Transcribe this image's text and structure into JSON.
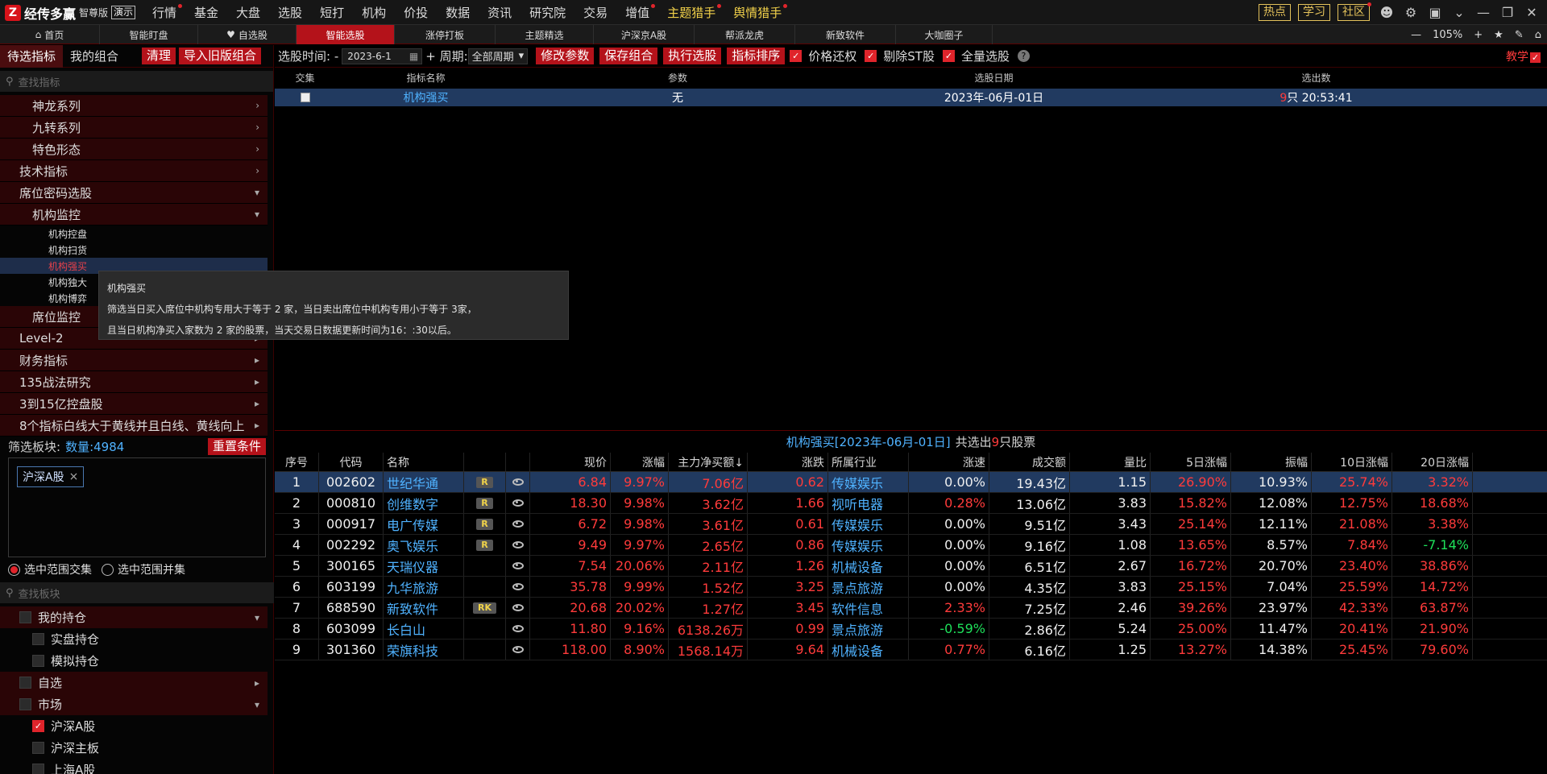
{
  "app": {
    "name": "经传多赢",
    "edition": "智尊版",
    "demo": "演示"
  },
  "top_menu": [
    {
      "label": "行情",
      "dot": true,
      "gold": false
    },
    {
      "label": "基金",
      "dot": false,
      "gold": false
    },
    {
      "label": "大盘",
      "dot": false,
      "gold": false
    },
    {
      "label": "选股",
      "dot": false,
      "gold": false
    },
    {
      "label": "短打",
      "dot": false,
      "gold": false
    },
    {
      "label": "机构",
      "dot": false,
      "gold": false
    },
    {
      "label": "价投",
      "dot": false,
      "gold": false
    },
    {
      "label": "数据",
      "dot": false,
      "gold": false
    },
    {
      "label": "资讯",
      "dot": false,
      "gold": false
    },
    {
      "label": "研究院",
      "dot": false,
      "gold": false
    },
    {
      "label": "交易",
      "dot": false,
      "gold": false
    },
    {
      "label": "增值",
      "dot": true,
      "gold": false
    },
    {
      "label": "主题猎手",
      "dot": true,
      "gold": true
    },
    {
      "label": "舆情猎手",
      "dot": true,
      "gold": true
    }
  ],
  "top_right": {
    "hot": "热点",
    "learn": "学习",
    "community": "社区"
  },
  "tabs": [
    {
      "label": "首页",
      "icon": "home-icon"
    },
    {
      "label": "智能盯盘",
      "icon": ""
    },
    {
      "label": "自选股",
      "icon": "heart-icon"
    },
    {
      "label": "智能选股",
      "icon": "",
      "active": true
    },
    {
      "label": "涨停打板",
      "icon": ""
    },
    {
      "label": "主题精选",
      "icon": ""
    },
    {
      "label": "沪深京A股",
      "icon": ""
    },
    {
      "label": "帮派龙虎",
      "icon": ""
    },
    {
      "label": "新致软件",
      "icon": ""
    },
    {
      "label": "大咖圈子",
      "icon": ""
    }
  ],
  "zoom": "105%",
  "left": {
    "tab_pending": "待选指标",
    "tab_combo": "我的组合",
    "clear": "清理",
    "import_old": "导入旧版组合",
    "search_placeholder": "查找指标",
    "tree_top": [
      {
        "label": "神龙系列",
        "indent": 40
      },
      {
        "label": "九转系列",
        "indent": 40
      },
      {
        "label": "特色形态",
        "indent": 40
      },
      {
        "label": "技术指标",
        "indent": 24
      },
      {
        "label": "席位密码选股",
        "indent": 24,
        "open": true
      },
      {
        "label": "机构监控",
        "indent": 40,
        "open": true
      }
    ],
    "leaves": [
      "机构控盘",
      "机构扫货",
      "机构强买",
      "机构独大",
      "机构博弈"
    ],
    "selected_leaf": "机构强买",
    "tree_bottom": [
      {
        "label": "席位监控",
        "indent": 40
      },
      {
        "label": "Level-2",
        "indent": 24
      },
      {
        "label": "财务指标",
        "indent": 24
      },
      {
        "label": "135战法研究",
        "indent": 24
      },
      {
        "label": "3到15亿控盘股",
        "indent": 24
      },
      {
        "label": "8个指标白线大于黄线并且白线、黄线向上",
        "indent": 24
      }
    ],
    "filter_label": "筛选板块:",
    "filter_count": "数量:4984",
    "reset": "重置条件",
    "chip": "沪深A股",
    "radio_intersect": "选中范围交集",
    "radio_union": "选中范围并集",
    "board_search_placeholder": "查找板块",
    "board_tree": [
      {
        "label": "我的持仓",
        "indent": 24,
        "dark": true,
        "arrow": "▾",
        "check": false
      },
      {
        "label": "实盘持仓",
        "indent": 40,
        "dark": false,
        "arrow": "",
        "check": false
      },
      {
        "label": "模拟持仓",
        "indent": 40,
        "dark": false,
        "arrow": "",
        "check": false
      },
      {
        "label": "自选",
        "indent": 24,
        "dark": true,
        "arrow": "▸",
        "check": false
      },
      {
        "label": "市场",
        "indent": 24,
        "dark": true,
        "arrow": "▾",
        "check": false
      },
      {
        "label": "沪深A股",
        "indent": 40,
        "dark": false,
        "arrow": "",
        "check": true
      },
      {
        "label": "沪深主板",
        "indent": 40,
        "dark": false,
        "arrow": "",
        "check": false
      },
      {
        "label": "上海A股",
        "indent": 40,
        "dark": false,
        "arrow": "",
        "check": false
      }
    ]
  },
  "tooltip": {
    "title": "机构强买",
    "line1": "筛选当日买入席位中机构专用大于等于 2 家，当日卖出席位中机构专用小于等于 3家，",
    "line2": "且当日机构净买入家数为 2 家的股票，当天交易日数据更新时间为16：:30以后。"
  },
  "toolbar": {
    "select_time": "选股时间: -",
    "date": "2023-6-1",
    "period_label": "+ 周期:",
    "period_value": "全部周期",
    "modify": "修改参数",
    "save": "保存组合",
    "run": "执行选股",
    "sort": "指标排序",
    "price_adjust": "价格还权",
    "exclude_st": "剔除ST股",
    "full": "全量选股",
    "help": "?",
    "teach": "教学"
  },
  "strategy": {
    "headers": [
      "交集",
      "指标名称",
      "参数",
      "选股日期",
      "选出数"
    ],
    "row": {
      "name": "机构强买",
      "params": "无",
      "date": "2023年-06月-01日",
      "count": "9",
      "count_suffix": "只 20:53:41"
    }
  },
  "results": {
    "title": "机构强买[2023年-06月-01日]",
    "summary_pre": "共选出",
    "count": "9",
    "summary_post": "只股票"
  },
  "stock_table": {
    "headers": [
      "序号",
      "代码",
      "名称",
      "",
      "",
      "现价",
      "涨幅",
      "主力净买额↓",
      "涨跌",
      "所属行业",
      "涨速",
      "成交额",
      "量比",
      "5日涨幅",
      "振幅",
      "10日涨幅",
      "20日涨幅"
    ],
    "rows": [
      {
        "no": "1",
        "code": "002602",
        "name": "世纪华通",
        "badge": "R",
        "price": "6.84",
        "chg": "9.97%",
        "net": "7.06亿",
        "change": "0.62",
        "industry": "传媒娱乐",
        "speed": "0.00%",
        "amount": "19.43亿",
        "ratio": "1.15",
        "d5": "26.90%",
        "amp": "10.93%",
        "d10": "25.74%",
        "d20": "3.32%",
        "speed_cls": "white",
        "d20_cls": "red",
        "sel": true
      },
      {
        "no": "2",
        "code": "000810",
        "name": "创维数字",
        "badge": "R",
        "price": "18.30",
        "chg": "9.98%",
        "net": "3.62亿",
        "change": "1.66",
        "industry": "视听电器",
        "speed": "0.28%",
        "amount": "13.06亿",
        "ratio": "3.83",
        "d5": "15.82%",
        "amp": "12.08%",
        "d10": "12.75%",
        "d20": "18.68%",
        "speed_cls": "red",
        "d20_cls": "red",
        "sel": false
      },
      {
        "no": "3",
        "code": "000917",
        "name": "电广传媒",
        "badge": "R",
        "price": "6.72",
        "chg": "9.98%",
        "net": "3.61亿",
        "change": "0.61",
        "industry": "传媒娱乐",
        "speed": "0.00%",
        "amount": "9.51亿",
        "ratio": "3.43",
        "d5": "25.14%",
        "amp": "12.11%",
        "d10": "21.08%",
        "d20": "3.38%",
        "speed_cls": "white",
        "d20_cls": "red",
        "sel": false
      },
      {
        "no": "4",
        "code": "002292",
        "name": "奥飞娱乐",
        "badge": "R",
        "price": "9.49",
        "chg": "9.97%",
        "net": "2.65亿",
        "change": "0.86",
        "industry": "传媒娱乐",
        "speed": "0.00%",
        "amount": "9.16亿",
        "ratio": "1.08",
        "d5": "13.65%",
        "amp": "8.57%",
        "d10": "7.84%",
        "d20": "-7.14%",
        "speed_cls": "white",
        "d20_cls": "green",
        "sel": false
      },
      {
        "no": "5",
        "code": "300165",
        "name": "天瑞仪器",
        "badge": "",
        "price": "7.54",
        "chg": "20.06%",
        "net": "2.11亿",
        "change": "1.26",
        "industry": "机械设备",
        "speed": "0.00%",
        "amount": "6.51亿",
        "ratio": "2.67",
        "d5": "16.72%",
        "amp": "20.70%",
        "d10": "23.40%",
        "d20": "38.86%",
        "speed_cls": "white",
        "d20_cls": "red",
        "sel": false
      },
      {
        "no": "6",
        "code": "603199",
        "name": "九华旅游",
        "badge": "",
        "price": "35.78",
        "chg": "9.99%",
        "net": "1.52亿",
        "change": "3.25",
        "industry": "景点旅游",
        "speed": "0.00%",
        "amount": "4.35亿",
        "ratio": "3.83",
        "d5": "25.15%",
        "amp": "7.04%",
        "d10": "25.59%",
        "d20": "14.72%",
        "speed_cls": "white",
        "d20_cls": "red",
        "sel": false
      },
      {
        "no": "7",
        "code": "688590",
        "name": "新致软件",
        "badge": "RK",
        "price": "20.68",
        "chg": "20.02%",
        "net": "1.27亿",
        "change": "3.45",
        "industry": "软件信息",
        "speed": "2.33%",
        "amount": "7.25亿",
        "ratio": "2.46",
        "d5": "39.26%",
        "amp": "23.97%",
        "d10": "42.33%",
        "d20": "63.87%",
        "speed_cls": "red",
        "d20_cls": "red",
        "sel": false
      },
      {
        "no": "8",
        "code": "603099",
        "name": "长白山",
        "badge": "",
        "price": "11.80",
        "chg": "9.16%",
        "net": "6138.26万",
        "change": "0.99",
        "industry": "景点旅游",
        "speed": "-0.59%",
        "amount": "2.86亿",
        "ratio": "5.24",
        "d5": "25.00%",
        "amp": "11.47%",
        "d10": "20.41%",
        "d20": "21.90%",
        "speed_cls": "green",
        "d20_cls": "red",
        "sel": false
      },
      {
        "no": "9",
        "code": "301360",
        "name": "荣旗科技",
        "badge": "",
        "price": "118.00",
        "chg": "8.90%",
        "net": "1568.14万",
        "change": "9.64",
        "industry": "机械设备",
        "speed": "0.77%",
        "amount": "6.16亿",
        "ratio": "1.25",
        "d5": "13.27%",
        "amp": "14.38%",
        "d10": "25.45%",
        "d20": "79.60%",
        "speed_cls": "red",
        "d20_cls": "red",
        "sel": false
      }
    ]
  }
}
